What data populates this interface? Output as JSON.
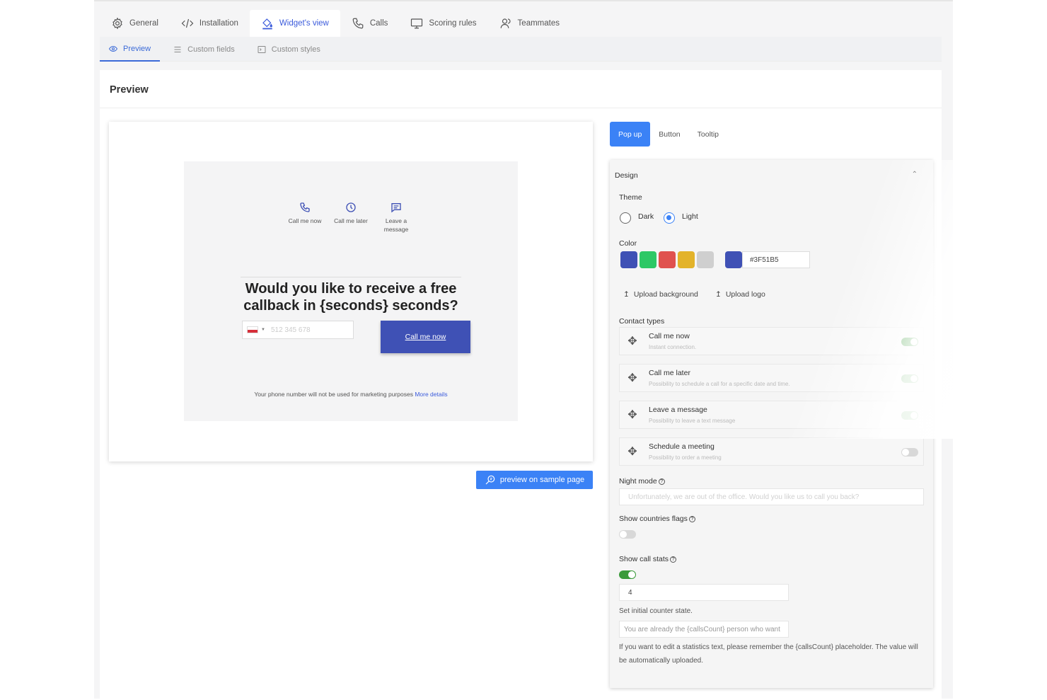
{
  "top_tabs": [
    {
      "label": "General",
      "icon": "gear-icon"
    },
    {
      "label": "Installation",
      "icon": "code-icon"
    },
    {
      "label": "Widget's view",
      "icon": "paint-bucket-icon"
    },
    {
      "label": "Calls",
      "icon": "phone-icon"
    },
    {
      "label": "Scoring rules",
      "icon": "monitor-icon"
    },
    {
      "label": "Teammates",
      "icon": "users-icon"
    }
  ],
  "sub_tabs": [
    {
      "label": "Preview",
      "icon": "eye-icon"
    },
    {
      "label": "Custom fields",
      "icon": "list-icon"
    },
    {
      "label": "Custom styles",
      "icon": "terminal-icon"
    }
  ],
  "page_title": "Preview",
  "widget": {
    "contact_types": [
      {
        "label": "Call me now",
        "icon": "phone-icon"
      },
      {
        "label": "Call me later",
        "icon": "clock-icon"
      },
      {
        "label": "Leave a message",
        "icon": "message-icon"
      }
    ],
    "leave_line1": "Leave a",
    "leave_line2": "message",
    "question": "Would you like to receive a free callback in {seconds} seconds?",
    "phone_placeholder": "512 345 678",
    "call_button": "Call me now",
    "consent_text": "Your phone number will not be used for marketing purposes",
    "consent_link": "More details"
  },
  "sample_button": "preview on sample page",
  "type_tabs": [
    "Pop up",
    "Button",
    "Tooltip"
  ],
  "design": {
    "header": "Design",
    "theme_label": "Theme",
    "theme_options": [
      "Dark",
      "Light"
    ],
    "theme_selected": "Light",
    "color_label": "Color",
    "swatches": [
      "#3f51b5",
      "#2ec866",
      "#e0524f",
      "#e3b32a",
      "#cfcfcf"
    ],
    "selected_color": "#3F51B5",
    "upload_background": "Upload background",
    "upload_logo": "Upload logo",
    "contact_types_label": "Contact types",
    "contact_types": [
      {
        "title": "Call me now",
        "desc": "Instant connection.",
        "enabled": true
      },
      {
        "title": "Call me later",
        "desc": "Possibility to schedule a call for a specific date and time.",
        "enabled": true
      },
      {
        "title": "Leave a message",
        "desc": "Possibility to leave a text message",
        "enabled": true
      },
      {
        "title": "Schedule a meeting",
        "desc": "Possibility to order a meeting",
        "enabled": false
      }
    ],
    "night_mode_label": "Night mode",
    "night_mode_placeholder": "Unfortunately, we are out of the office. Would you like us to call you back?",
    "show_flags_label": "Show countries flags",
    "show_flags_enabled": false,
    "show_stats_label": "Show call stats",
    "show_stats_enabled": true,
    "counter_value": "4",
    "counter_hint": "Set initial counter state.",
    "stats_text_placeholder": "You are already the {callsCount} person who want",
    "stats_note": "If you want to edit a statistics text, please remember the {callsCount} placeholder. The value will be automatically uploaded."
  }
}
